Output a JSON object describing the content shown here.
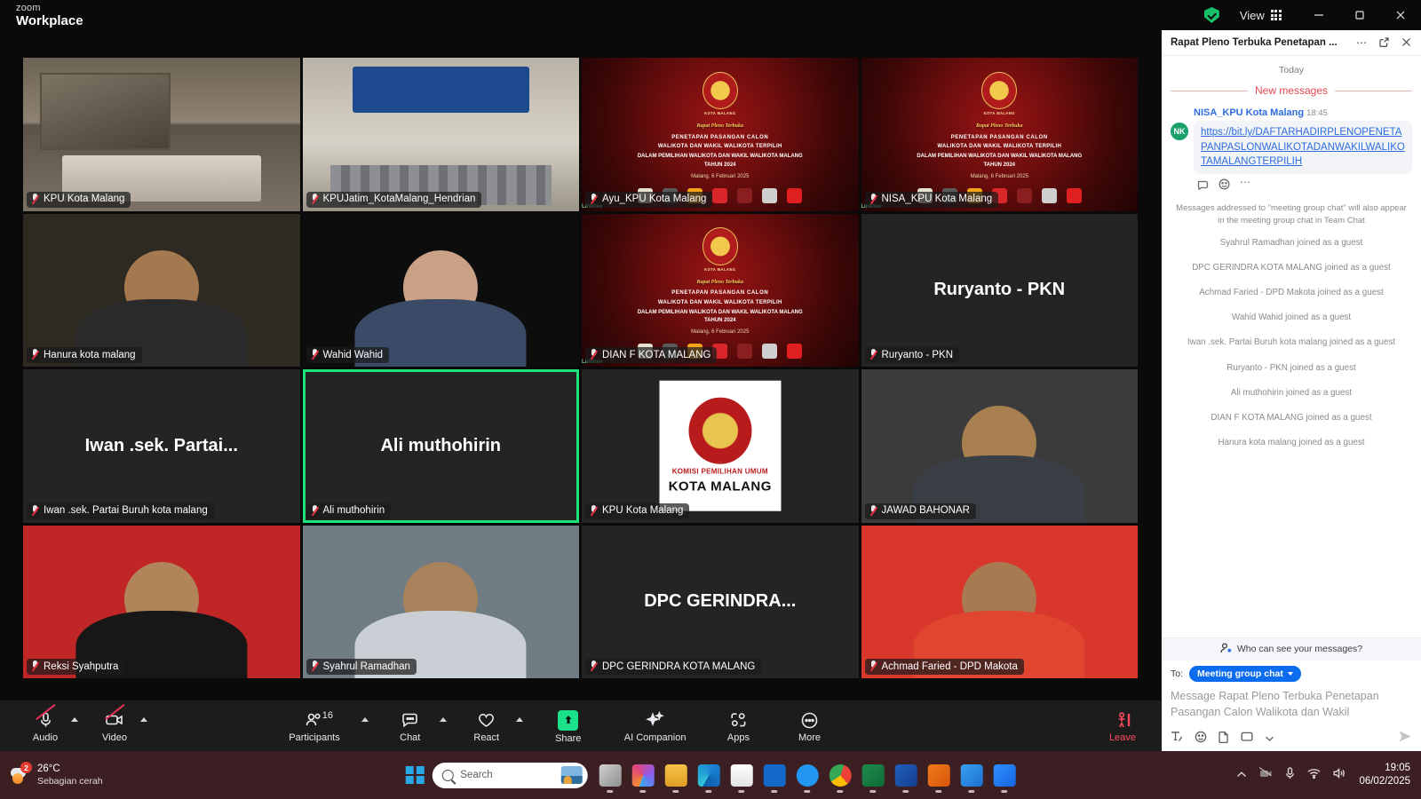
{
  "titlebar": {
    "brand_small": "zoom",
    "brand_large": "Workplace",
    "view_label": "View",
    "shield_icon": "security-shield-icon",
    "minimize_icon": "minimize-icon",
    "maximize_icon": "maximize-icon",
    "close_icon": "close-icon"
  },
  "tiles": [
    {
      "name": "KPU Kota Malang",
      "kind": "room",
      "center": "",
      "active": false
    },
    {
      "name": "KPUJatim_KotaMalang_Hendrian",
      "kind": "gate",
      "center": "",
      "active": false
    },
    {
      "name": "Ayu_KPU Kota Malang",
      "kind": "slide",
      "center": "",
      "active": false
    },
    {
      "name": "NISA_KPU Kota Malang",
      "kind": "slide",
      "center": "",
      "active": false
    },
    {
      "name": "Hanura kota malang",
      "kind": "person",
      "center": "",
      "active": false
    },
    {
      "name": "Wahid Wahid",
      "kind": "person",
      "center": "",
      "active": false
    },
    {
      "name": "DIAN F KOTA MALANG",
      "kind": "slide",
      "center": "",
      "active": false
    },
    {
      "name": "Ruryanto - PKN",
      "kind": "text",
      "center": "Ruryanto - PKN",
      "active": false
    },
    {
      "name": "Iwan .sek. Partai Buruh kota malang",
      "kind": "text",
      "center": "Iwan .sek. Partai...",
      "active": false
    },
    {
      "name": "Ali muthohirin",
      "kind": "text",
      "center": "Ali muthohirin",
      "active": true
    },
    {
      "name": "KPU Kota Malang",
      "kind": "kpulogo",
      "center": "",
      "active": false
    },
    {
      "name": "JAWAD BAHONAR",
      "kind": "person",
      "center": "",
      "active": false
    },
    {
      "name": "Reksi Syahputra",
      "kind": "person",
      "center": "",
      "active": false
    },
    {
      "name": "Syahrul Ramadhan",
      "kind": "person",
      "center": "",
      "active": false
    },
    {
      "name": "DPC GERINDRA KOTA MALANG",
      "kind": "text",
      "center": "DPC  GERINDRA...",
      "active": false
    },
    {
      "name": "Achmad Faried - DPD Makota",
      "kind": "person",
      "center": "",
      "active": false
    }
  ],
  "slide": {
    "org": "KOTA MALANG",
    "title": "Rapat Pleno Terbuka",
    "sub1": "PENETAPAN PASANGAN CALON",
    "sub2": "WALIKOTA DAN WAKIL WALIKOTA TERPILIH",
    "sub3": "DALAM PEMILIHAN WALIKOTA DAN WAKIL WALIKOTA MALANG",
    "sub4": "TAHUN 2024",
    "date": "Malang, 6 Februari 2025",
    "linktree": "Linktree"
  },
  "kpu_logo_tile": {
    "line1": "KOMISI PEMILIHAN UMUM",
    "line2": "KOTA MALANG"
  },
  "toolbar": {
    "audio": {
      "label": "Audio",
      "icon": "microphone-muted-icon",
      "muted": true
    },
    "video": {
      "label": "Video",
      "icon": "camera-muted-icon",
      "muted": true
    },
    "participants": {
      "label": "Participants",
      "icon": "participants-icon",
      "count": "16"
    },
    "chat": {
      "label": "Chat",
      "icon": "chat-bubble-icon"
    },
    "react": {
      "label": "React",
      "icon": "heart-icon"
    },
    "share": {
      "label": "Share",
      "icon": "share-screen-icon"
    },
    "ai_companion": {
      "label": "AI Companion",
      "icon": "sparkle-icon"
    },
    "apps": {
      "label": "Apps",
      "icon": "apps-icon"
    },
    "more": {
      "label": "More",
      "icon": "ellipsis-icon"
    },
    "leave": {
      "label": "Leave",
      "icon": "leave-meeting-icon"
    }
  },
  "chat_panel": {
    "title": "Rapat Pleno Terbuka Penetapan ...",
    "more_icon": "more-options-icon",
    "popout_icon": "pop-out-icon",
    "close_icon": "close-icon",
    "today": "Today",
    "new_messages": "New messages",
    "message": {
      "sender": "NISA_KPU Kota Malang",
      "time": "18:45",
      "avatar_initials": "NK",
      "link_text": "https://bit.ly/DAFTARHADIRPLENOPENETAPANPASLONWALIKOTADANWAKILWALIKOTAMALANGTERPILIH",
      "reply_icon": "reply-icon",
      "emoji_icon": "emoji-reaction-icon",
      "more_icon": "more-actions-icon"
    },
    "note": "Messages addressed to \"meeting group chat\" will also appear in the meeting group chat in Team Chat",
    "system_messages": [
      "Syahrul Ramadhan joined as a guest",
      "DPC GERINDRA KOTA MALANG joined as a guest",
      "Achmad Faried - DPD Makota joined as a guest",
      "Wahid Wahid joined as a guest",
      "Iwan .sek. Partai Buruh kota malang joined as a guest",
      "Ruryanto - PKN joined as a guest",
      "Ali muthohirin joined as a guest",
      "DIAN F KOTA MALANG joined as a guest",
      "Hanura kota malang joined as a guest"
    ],
    "who_can_see": "Who can see your messages?",
    "to_label": "To:",
    "recipient": "Meeting group chat",
    "input_placeholder": "Message Rapat Pleno Terbuka Penetapan Pasangan Calon Walikota dan Wakil",
    "tools": [
      "format-text-icon",
      "emoji-icon",
      "file-attach-icon",
      "screenshot-icon",
      "more-tools-icon"
    ],
    "send_icon": "send-icon"
  },
  "taskbar": {
    "weather": {
      "temp": "26°C",
      "condition": "Sebagian cerah",
      "badge": "2",
      "icon": "weather-partly-cloudy-icon"
    },
    "start_icon": "windows-start-icon",
    "search_placeholder": "Search",
    "apps": [
      "task-view-icon",
      "copilot-icon",
      "file-explorer-icon",
      "edge-icon",
      "microsoft-store-icon",
      "mydp-icon",
      "help-icon",
      "chrome-icon",
      "excel-icon",
      "word-icon",
      "gpss-icon",
      "photos-icon",
      "zoom-icon"
    ],
    "tray": [
      "show-hidden-icons-icon",
      "camera-off-icon",
      "microphone-icon",
      "wifi-icon",
      "speaker-icon"
    ],
    "time": "19:05",
    "date": "06/02/2025"
  },
  "colors": {
    "accent_green": "#1de17c",
    "leave_red": "#ff4a5e",
    "chat_blue": "#0b6cf0",
    "new_messages_red": "#e8484f",
    "taskbar": "#3c1f23"
  }
}
